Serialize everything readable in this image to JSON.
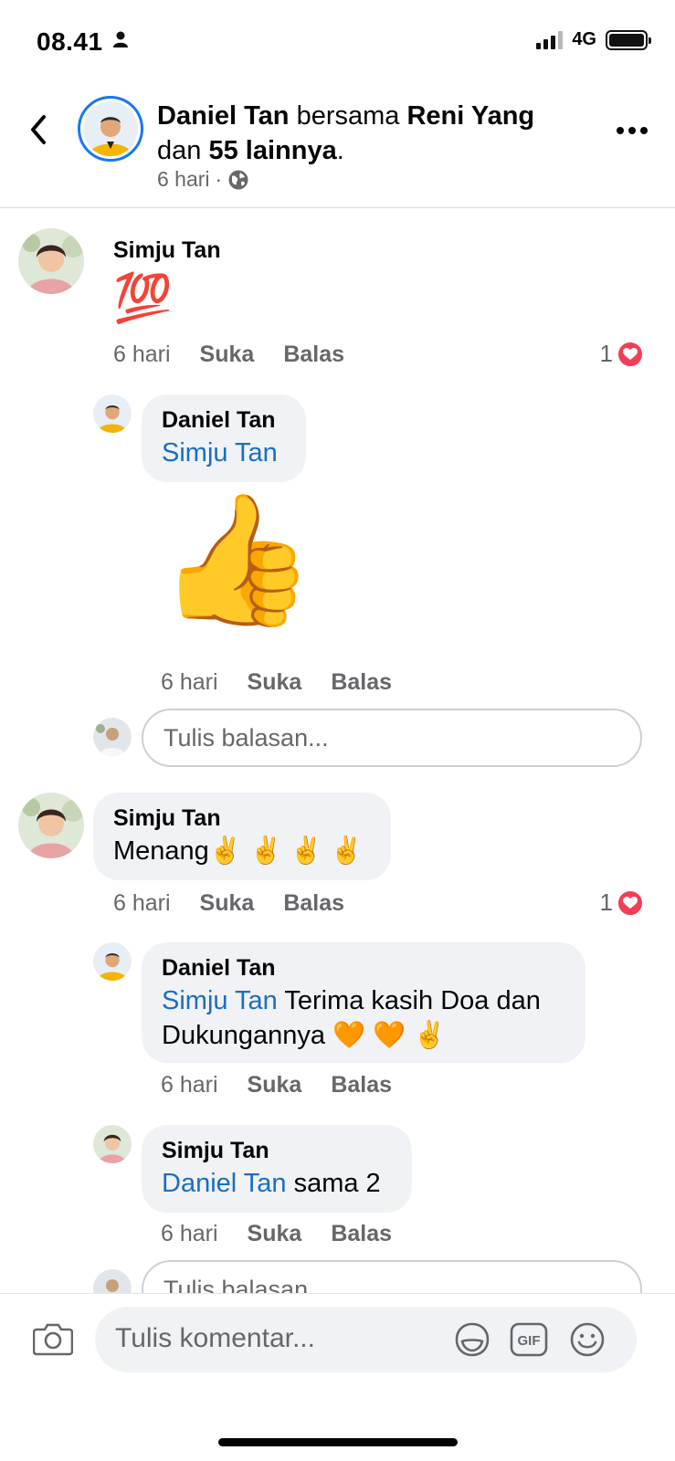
{
  "status_bar": {
    "time": "08.41",
    "network": "4G"
  },
  "header": {
    "author": "Daniel Tan",
    "with_word": "bersama",
    "tagged": "Reni Yang",
    "and_word": "dan",
    "others": "55 lainnya",
    "period": ".",
    "time": "6 hari",
    "dot": "·"
  },
  "comments": [
    {
      "name": "Simju Tan",
      "text": "💯",
      "time": "6 hari",
      "like_label": "Suka",
      "reply_label": "Balas",
      "reaction_count": "1"
    },
    {
      "name": "Daniel Tan",
      "mention": "Simju Tan",
      "sticker": "👍",
      "time": "6 hari",
      "like_label": "Suka",
      "reply_label": "Balas"
    },
    {
      "name": "Simju Tan",
      "text": "Menang✌️ ✌️ ✌️ ✌️",
      "time": "6 hari",
      "like_label": "Suka",
      "reply_label": "Balas",
      "reaction_count": "1"
    },
    {
      "name": "Daniel Tan",
      "mention": "Simju Tan",
      "text_line1": "Terima kasih Doa dan",
      "text_line2": "Dukungannya 🧡 🧡 ✌️",
      "time": "6 hari",
      "like_label": "Suka",
      "reply_label": "Balas"
    },
    {
      "name": "Simju Tan",
      "mention": "Daniel Tan",
      "text": "sama 2",
      "time": "6 hari",
      "like_label": "Suka",
      "reply_label": "Balas"
    }
  ],
  "reply_placeholder": "Tulis balasan...",
  "reply_placeholder_cut": "Tulis balasan",
  "comment_placeholder": "Tulis komentar...",
  "gif_label": "GIF",
  "icons": [
    "back-icon",
    "more-icon",
    "globe-icon",
    "camera-icon",
    "sticker-icon",
    "gif-icon",
    "emoji-icon",
    "heart-icon",
    "person-icon"
  ],
  "colors": {
    "accent": "#1877f2",
    "mention": "#1a6ec2",
    "bubble": "#f0f2f5",
    "secondary_text": "#65676b",
    "heart": "#f33e58"
  }
}
